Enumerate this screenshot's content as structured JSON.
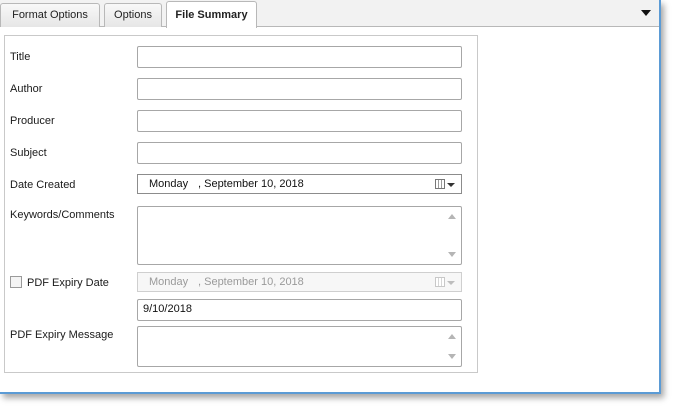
{
  "tabs": [
    {
      "label": "Format Options",
      "active": false
    },
    {
      "label": "Options",
      "active": false
    },
    {
      "label": "File Summary",
      "active": true
    }
  ],
  "form": {
    "title_label": "Title",
    "title_value": "",
    "author_label": "Author",
    "author_value": "",
    "producer_label": "Producer",
    "producer_value": "",
    "subject_label": "Subject",
    "subject_value": "",
    "date_created_label": "Date Created",
    "date_created_day": "Monday",
    "date_created_rest": ", September 10, 2018",
    "keywords_label": "Keywords/Comments",
    "keywords_value": "",
    "pdf_expiry_label": "PDF Expiry Date",
    "pdf_expiry_checked": false,
    "pdf_expiry_day": "Monday",
    "pdf_expiry_rest": ", September 10, 2018",
    "pdf_expiry_short": "9/10/2018",
    "pdf_expiry_message_label": "PDF Expiry Message",
    "pdf_expiry_message_value": ""
  },
  "colors": {
    "frame_border": "#5b9bd5",
    "tab_border": "#b8b8b8"
  }
}
